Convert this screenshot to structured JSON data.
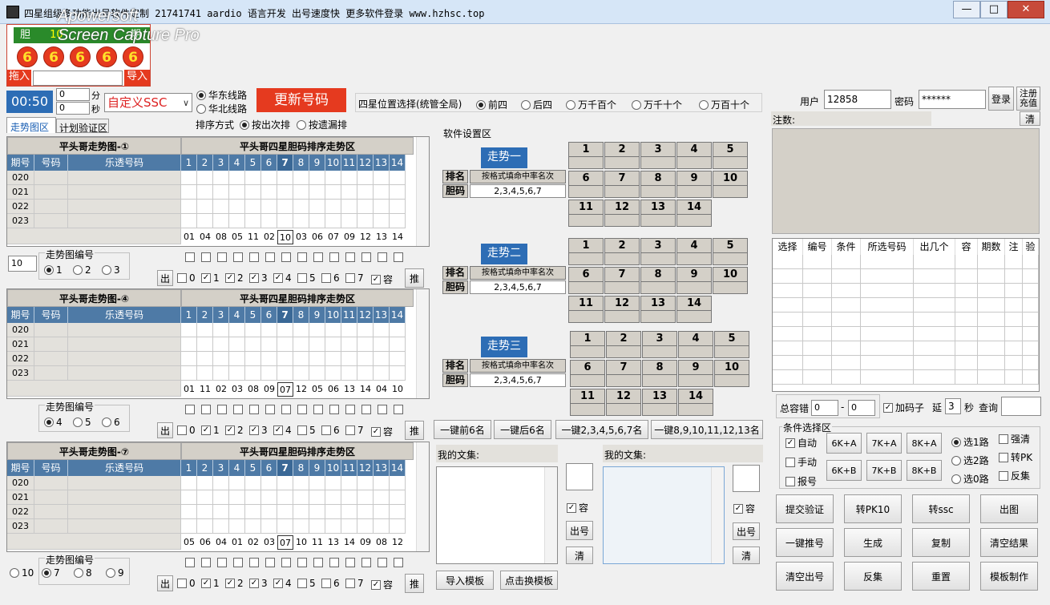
{
  "window": {
    "title": "四星组级多功能出号软件定制 21741741 aardio 语言开发 出号速度快 更多软件登录 www.hzhsc.top",
    "controls": [
      "—",
      "□",
      "✕"
    ]
  },
  "watermark": {
    "line1": "Apowersoft",
    "line2": "Screen Capture Pro"
  },
  "logo": {
    "left": "胆",
    "mid": "10",
    "right": "期"
  },
  "balls": [
    "6",
    "6",
    "6",
    "6",
    "6"
  ],
  "import_bar": {
    "drag_in": "拖入",
    "import": "导入"
  },
  "timer": {
    "time": "00:50",
    "min_value": "0",
    "min_unit": "分",
    "sec_value": "0",
    "sec_unit": "秒",
    "lottery": "自定义SSC"
  },
  "line_select": {
    "east": "华东线路",
    "north": "华北线路",
    "update": "更新号码"
  },
  "sort": {
    "label": "排序方式",
    "opt1": "按出次排",
    "opt2": "按遗漏排"
  },
  "tabs": {
    "trend": "走势图区",
    "plan": "计划验证区"
  },
  "grid_headers": {
    "col1": "期号",
    "col2": "号码",
    "col3": "乐透号码"
  },
  "col_nums": [
    "1",
    "2",
    "3",
    "4",
    "5",
    "6",
    "7",
    "8",
    "9",
    "10",
    "11",
    "12",
    "13",
    "14"
  ],
  "periods": [
    "020",
    "021",
    "022",
    "023"
  ],
  "charts": [
    {
      "title_left": "平头哥走势图-①",
      "title_right": "平头哥四星胆码排序走势区",
      "bottom": [
        "01",
        "04",
        "08",
        "05",
        "11",
        "02",
        "10",
        "03",
        "06",
        "07",
        "09",
        "12",
        "13",
        "14"
      ],
      "boxed_index": 6,
      "num_label": "走势图编号",
      "spin": "10",
      "radios": [
        "1",
        "2",
        "3"
      ],
      "radio_on": 0
    },
    {
      "title_left": "平头哥走势图-④",
      "title_right": "平头哥四星胆码排序走势区",
      "bottom": [
        "01",
        "11",
        "02",
        "03",
        "08",
        "09",
        "07",
        "12",
        "05",
        "06",
        "13",
        "14",
        "04",
        "10"
      ],
      "boxed_index": 6,
      "num_label": "走势图编号",
      "radios": [
        "4",
        "5",
        "6"
      ],
      "radio_on": 0
    },
    {
      "title_left": "平头哥走势图-⑦",
      "title_right": "平头哥四星胆码排序走势区",
      "bottom": [
        "05",
        "06",
        "04",
        "01",
        "02",
        "03",
        "07",
        "10",
        "11",
        "13",
        "14",
        "09",
        "08",
        "12"
      ],
      "boxed_index": 6,
      "num_label": "走势图编号",
      "radios": [
        "10",
        "7",
        "8",
        "9"
      ],
      "radio_on": 1
    }
  ],
  "out_row": {
    "out": "出",
    "push": "推",
    "opts": [
      "0",
      "1",
      "2",
      "3",
      "4",
      "5",
      "6",
      "7"
    ],
    "on": [
      1,
      2,
      3,
      4
    ],
    "rong": "容"
  },
  "position": {
    "label": "四星位置选择(统管全局)",
    "opts": [
      "前四",
      "后四",
      "万千百个",
      "万千十个",
      "万百十个"
    ],
    "on": 0
  },
  "software": {
    "title": "软件设置区",
    "blocks": [
      {
        "name": "走势一"
      },
      {
        "name": "走势二"
      },
      {
        "name": "走势三"
      }
    ],
    "rank_label": "排名",
    "rank_value": "按格式填命中率名次",
    "dan_label": "胆码",
    "dan_value": "2,3,4,5,6,7",
    "nums": [
      "1",
      "2",
      "3",
      "4",
      "5",
      "6",
      "7",
      "8",
      "9",
      "10",
      "11",
      "12",
      "13",
      "14"
    ]
  },
  "quick_buttons": [
    "一键前6名",
    "一键后6名",
    "一键2,3,4,5,6,7名",
    "一键8,9,10,11,12,13名"
  ],
  "collections": {
    "mine1": "我的文集:",
    "mine2": "我的文集:",
    "rong": "容",
    "out": "出号",
    "clear": "清",
    "import_tpl": "导入模板",
    "switch_tpl": "点击换模板"
  },
  "login": {
    "user_label": "用户",
    "user_value": "12858",
    "pass_label": "密码",
    "pass_value": "******",
    "login": "登录",
    "register": "注册\n充值"
  },
  "notes": {
    "label": "注数:",
    "clear": "清"
  },
  "cond_table": {
    "cols": [
      "选择",
      "编号",
      "条件",
      "所选号码",
      "出几个",
      "容",
      "期数",
      "注",
      "验"
    ]
  },
  "tolerance": {
    "label": "总容错",
    "v1": "0",
    "dash": "-",
    "v2": "0",
    "add_sub": "加码子",
    "delay_label": "延",
    "delay_value": "3",
    "sec": "秒",
    "query": "查询"
  },
  "conditions": {
    "title": "条件选择区",
    "auto": "自动",
    "manual": "手动",
    "report": "报号",
    "k_buttons": [
      "6K+A",
      "7K+A",
      "8K+A",
      "6K+B",
      "7K+B",
      "8K+B"
    ],
    "roads": [
      "选1路",
      "选2路",
      "选0路"
    ],
    "road_on": 0,
    "opts": [
      "强清",
      "转PK",
      "反集"
    ]
  },
  "actions": [
    "提交验证",
    "转PK10",
    "转ssc",
    "出图",
    "一键推号",
    "生成",
    "复制",
    "清空结果",
    "清空出号",
    "反集",
    "重置",
    "模板制作"
  ]
}
